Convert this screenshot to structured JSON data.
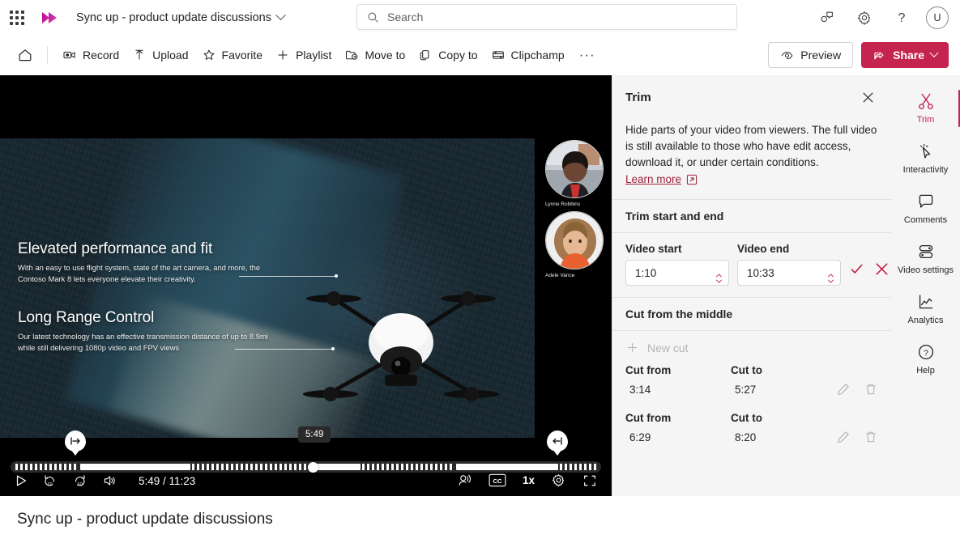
{
  "topbar": {
    "waffle_label": "app-launcher",
    "app_title": "Sync up - product update discussions",
    "search_placeholder": "Search",
    "search_value": "",
    "avatar_initial": "U"
  },
  "commandbar": {
    "items": [
      {
        "label": "Record",
        "icon": "record-icon"
      },
      {
        "label": "Upload",
        "icon": "upload-icon"
      },
      {
        "label": "Favorite",
        "icon": "star-icon"
      },
      {
        "label": "Playlist",
        "icon": "plus-icon"
      },
      {
        "label": "Move to",
        "icon": "move-to-icon"
      },
      {
        "label": "Copy to",
        "icon": "copy-to-icon"
      },
      {
        "label": "Clipchamp",
        "icon": "clipchamp-icon"
      }
    ],
    "overflow_label": "···",
    "preview_label": "Preview",
    "share_label": "Share"
  },
  "player": {
    "current_time": "5:49",
    "total_time": "11:23",
    "time_display": "5:49 / 11:23",
    "scrub_tooltip": "5:49",
    "speed": "1x",
    "cc_label": "CC",
    "slide": {
      "heading1": "Elevated performance and fit",
      "body1": "With an easy to use flight system, state of the art camera, and more, the Contoso Mark 8 lets everyone elevate their creativity.",
      "heading2": "Long Range Control",
      "body2": "Our latest technology has an effective transmission distance of up to 8.9mi while still delivering 1080p video and FPV views"
    },
    "participants": [
      {
        "name": "Lynne Robbins"
      },
      {
        "name": "Adele Vance"
      }
    ]
  },
  "trim_panel": {
    "title": "Trim",
    "description": "Hide parts of your video from viewers. The full video is still available to those who have edit access, download it, or under certain conditions.",
    "learn_more": "Learn more",
    "section_start_end": "Trim start and end",
    "video_start_label": "Video start",
    "video_start_value": "1:10",
    "video_end_label": "Video end",
    "video_end_value": "10:33",
    "section_middle": "Cut from the middle",
    "new_cut_label": "New cut",
    "cut_from_label": "Cut from",
    "cut_to_label": "Cut to",
    "cuts": [
      {
        "from": "3:14",
        "to": "5:27"
      },
      {
        "from": "6:29",
        "to": "8:20"
      }
    ]
  },
  "rail": {
    "items": [
      {
        "label": "Trim",
        "icon": "scissors-icon",
        "active": true
      },
      {
        "label": "Interactivity",
        "icon": "cursor-sparkle-icon",
        "active": false
      },
      {
        "label": "Comments",
        "icon": "comment-bubble-icon",
        "active": false
      },
      {
        "label": "Video settings",
        "icon": "toggles-icon",
        "active": false
      },
      {
        "label": "Analytics",
        "icon": "line-chart-icon",
        "active": false
      },
      {
        "label": "Help",
        "icon": "question-circle-icon",
        "active": false
      }
    ]
  },
  "footer": {
    "video_title": "Sync up - product update discussions"
  },
  "colors": {
    "brand": "#c4244e",
    "accent_link": "#9d2235",
    "panel_bg": "#f5f5f5",
    "text": "#242424"
  }
}
